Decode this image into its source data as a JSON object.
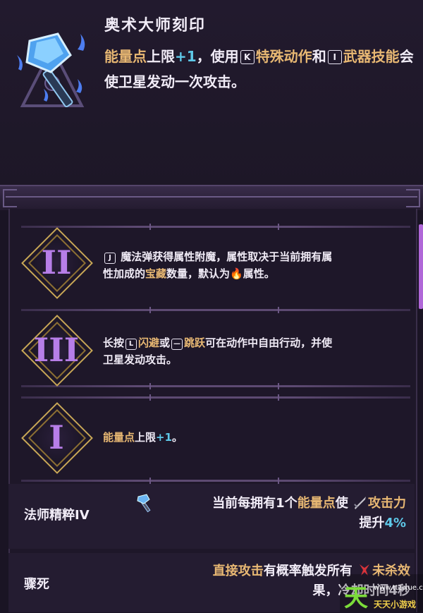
{
  "item": {
    "title": "奥术大师刻印",
    "desc_parts": {
      "p1": "能量点",
      "p2": "上限",
      "p3": "+1",
      "p4": "，使用",
      "key_k": "K",
      "p5": "特殊动作",
      "p6": "和",
      "key_i": "I",
      "p7": "武器技能",
      "p8": "会使卫星发动一次攻击。"
    }
  },
  "upgrades": [
    {
      "roman": "II",
      "key": "J",
      "text_a": "魔法弹获得属性附魔，属性取决于当前拥有属",
      "text_b": "性加成的",
      "text_c": "宝藏",
      "text_d": "数量，默认为",
      "fire": "🔥",
      "text_e": "属性。"
    },
    {
      "roman": "III",
      "text_a": "长按",
      "key_l": "L",
      "text_b": "闪避",
      "text_c": "或",
      "text_d": "跳跃",
      "text_e": "可在动作中自由行动，并使",
      "text_f": "卫星发动攻击。"
    },
    {
      "roman": "I",
      "text_a": "能量点",
      "text_b": "上限",
      "text_c": "+1",
      "text_d": "。"
    }
  ],
  "stats": [
    {
      "name": "法师精粹IV",
      "text_a": "当前每拥有1个",
      "text_b": "能量点",
      "text_c": "使",
      "text_d": "攻击力",
      "text_e": "提升",
      "text_f": "4%"
    },
    {
      "name": "骤死",
      "text_a": "直接攻击",
      "text_b": "有概率触发所有",
      "text_c": "未杀效",
      "text_d": "果，冷却时间4秒"
    }
  ],
  "watermark": {
    "char": "天",
    "site": "www.ttzixue.com",
    "label": "天天小游戏"
  },
  "colors": {
    "gold": "#e8b873",
    "blue": "#5ec8e8",
    "purple": "#b77ee8",
    "frame": "#c9a857"
  },
  "icons": [
    "crystal-hammer-icon",
    "sword-icon",
    "skull-icon",
    "fire-icon"
  ]
}
